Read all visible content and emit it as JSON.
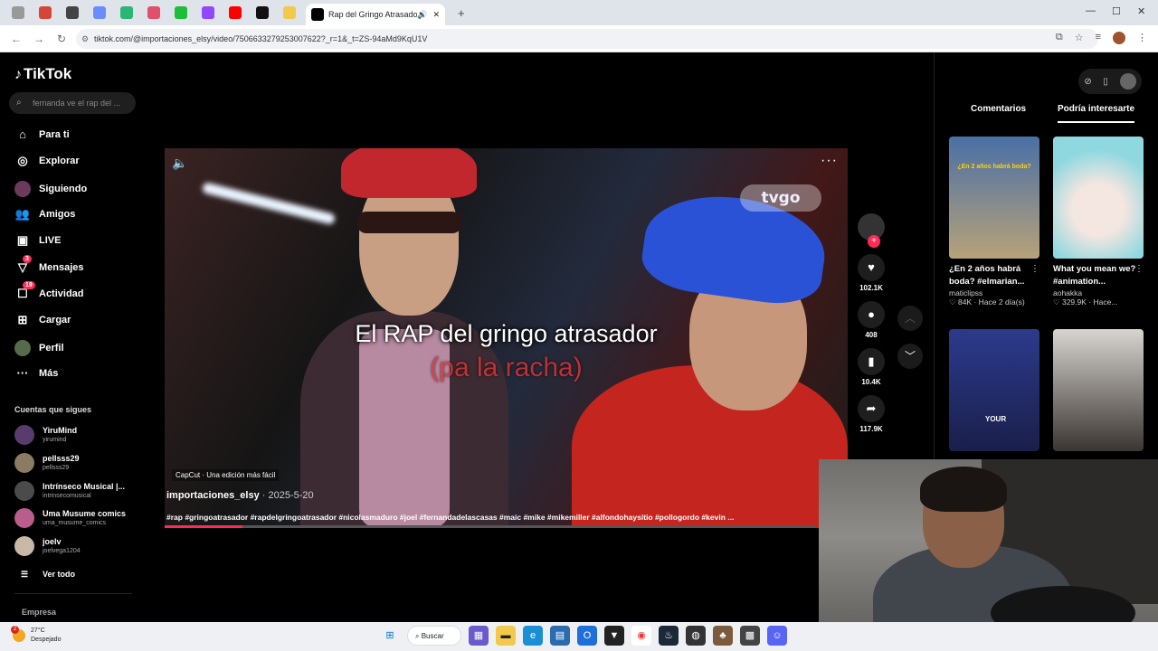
{
  "browser": {
    "active_tab_title": "Rap del Gringo Atrasador",
    "url": "tiktok.com/@importaciones_elsy/video/7506633279253007622?_r=1&_t=ZS-94aMd9KqU1V"
  },
  "sidebar": {
    "logo": "TikTok",
    "search_placeholder": "fernanda ve el rap del ...",
    "nav": [
      {
        "label": "Para ti",
        "icon": "home-icon"
      },
      {
        "label": "Explorar",
        "icon": "compass-icon"
      },
      {
        "label": "Siguiendo",
        "icon": "following-icon"
      },
      {
        "label": "Amigos",
        "icon": "friends-icon"
      },
      {
        "label": "LIVE",
        "icon": "live-icon"
      },
      {
        "label": "Mensajes",
        "icon": "messages-icon",
        "badge": "3"
      },
      {
        "label": "Actividad",
        "icon": "activity-icon",
        "badge": "19"
      },
      {
        "label": "Cargar",
        "icon": "upload-icon"
      },
      {
        "label": "Perfil",
        "icon": "profile-icon"
      },
      {
        "label": "Más",
        "icon": "more-icon"
      }
    ],
    "following_title": "Cuentas que sigues",
    "following": [
      {
        "name": "YiruMind",
        "handle": "yirumind"
      },
      {
        "name": "pellsss29",
        "handle": "pellsss29"
      },
      {
        "name": "Intrínseco Musical |...",
        "handle": "intrinsecomusical"
      },
      {
        "name": "Uma Musume comics",
        "handle": "uma_musume_comics"
      },
      {
        "name": "joelv",
        "handle": "joelvega1204"
      }
    ],
    "see_all": "Ver todo",
    "footer": "Empresa"
  },
  "video": {
    "watermark": "tvgo",
    "caption_line1": "El RAP del gringo atrasador",
    "caption_line2": "(pa la racha)",
    "capcut": "CapCut · Una edición más fácil",
    "author": "importaciones_elsy",
    "date": "2025-5-20",
    "tags": "#rap #gringoatrasador #rapdelgringoatrasador #nicolasmaduro #joel #fernandadelascasas #maic #mike #mikemiller #alfondohaysitio #pollogordo #kevin ...",
    "progress": 0.12
  },
  "actions": {
    "likes": "102.1K",
    "comments": "408",
    "saves": "10.4K",
    "shares": "117.9K"
  },
  "right_panel": {
    "tabs": [
      "Comentarios",
      "Podría interesarte"
    ],
    "cards": [
      {
        "title": "¿En 2 años habrá boda? #elmarian...",
        "user": "maticlipss",
        "meta": "♡ 84K · Hace 2 día(s)",
        "thumb_text": "¿En 2 años habrá boda?",
        "color": "#4a6fa5"
      },
      {
        "title": "What you mean we? #animation...",
        "user": "aohakka",
        "meta": "♡ 329.9K · Hace...",
        "thumb_text": "",
        "color": "#bfe6ee"
      },
      {
        "title": "",
        "user": "",
        "meta": "",
        "thumb_text": "YOUR",
        "color": "#2c3a8c"
      },
      {
        "title": "",
        "user": "",
        "meta": "",
        "thumb_text": "",
        "color": "#3a3530"
      }
    ]
  },
  "taskbar": {
    "temp": "27°C",
    "weather": "Despejado",
    "weather_badge": "2",
    "search": "Buscar"
  }
}
